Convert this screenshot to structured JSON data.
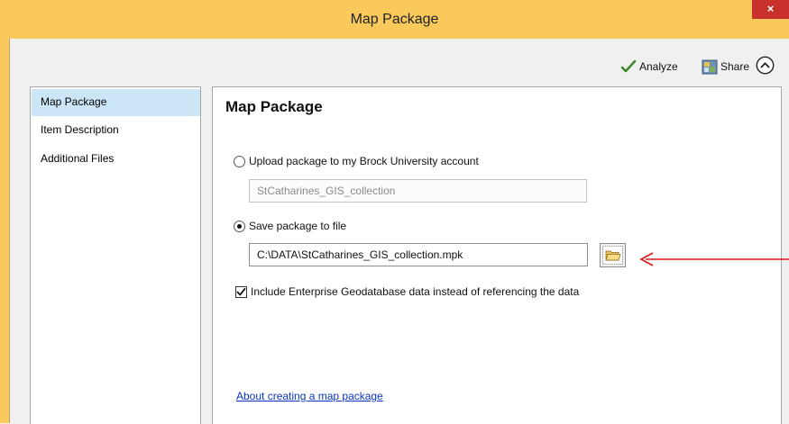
{
  "window": {
    "title": "Map Package",
    "close_label": "×"
  },
  "toolbar": {
    "analyze_label": "Analyze",
    "share_label": "Share"
  },
  "nav": {
    "items": [
      {
        "label": "Map Package",
        "selected": true
      },
      {
        "label": "Item Description",
        "selected": false
      },
      {
        "label": "Additional Files",
        "selected": false
      }
    ]
  },
  "panel": {
    "heading": "Map Package",
    "upload_option": {
      "label": "Upload package to my Brock University account",
      "selected": false,
      "value": "StCatharines_GIS_collection"
    },
    "save_option": {
      "label": "Save package to file",
      "selected": true,
      "value": "C:\\DATA\\StCatharines_GIS_collection.mpk"
    },
    "include_enterprise": {
      "label": "Include Enterprise Geodatabase data instead of referencing the data",
      "checked": true
    },
    "help_link": "About creating a map package"
  },
  "colors": {
    "title_bar": "#f9c95c",
    "close_button": "#c7302b",
    "selection": "#cde6f7",
    "link": "#0b35c8",
    "annotation_arrow": "#e01414"
  },
  "icons": {
    "analyze": "checkmark-icon",
    "share": "share-icon",
    "collapse": "chevron-up-icon",
    "browse": "folder-icon"
  }
}
